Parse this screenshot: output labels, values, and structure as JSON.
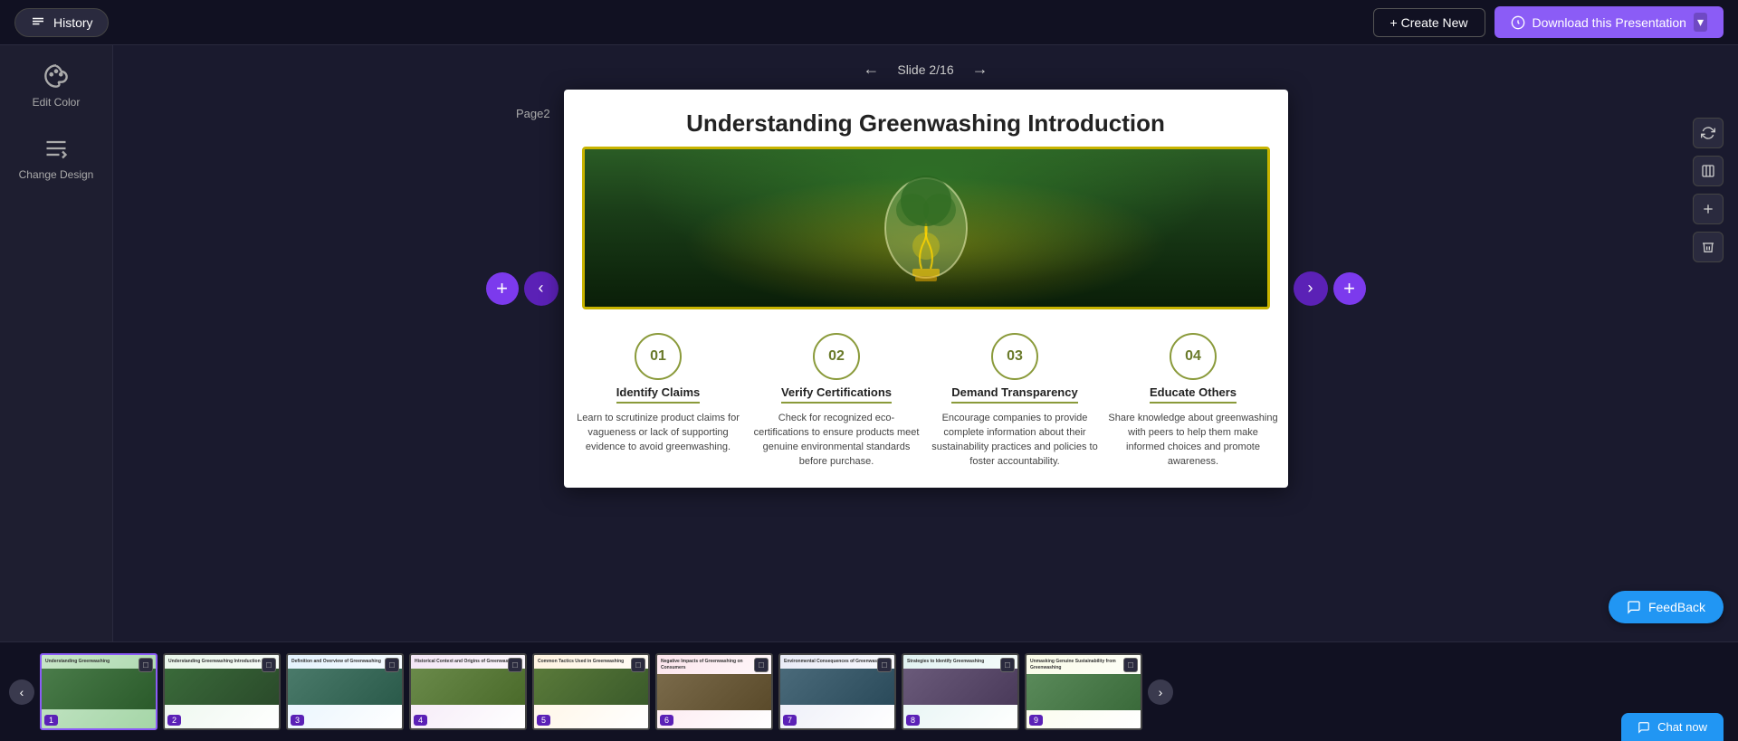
{
  "topbar": {
    "history_label": "History",
    "create_new_label": "+ Create New",
    "download_label": "Download this Presentation"
  },
  "sidebar": {
    "edit_color_label": "Edit Color",
    "change_design_label": "Change Design"
  },
  "slide": {
    "page_label": "Page2",
    "nav_label": "Slide 2/16",
    "title": "Understanding Greenwashing Introduction",
    "points": [
      {
        "number": "01",
        "title": "Identify Claims",
        "desc": "Learn to scrutinize product claims for vagueness or lack of supporting evidence to avoid greenwashing."
      },
      {
        "number": "02",
        "title": "Verify Certifications",
        "desc": "Check for recognized eco-certifications to ensure products meet genuine environmental standards before purchase."
      },
      {
        "number": "03",
        "title": "Demand Transparency",
        "desc": "Encourage companies to provide complete information about their sustainability practices and policies to foster accountability."
      },
      {
        "number": "04",
        "title": "Educate Others",
        "desc": "Share knowledge about greenwashing with peers to help them make informed choices and promote awareness."
      }
    ]
  },
  "thumbnails": [
    {
      "badge": "1",
      "label": "Understanding Greenwashing...",
      "color": "t1",
      "active": true
    },
    {
      "badge": "2",
      "label": "Understanding Greenwashing Introduction",
      "color": "t2",
      "active": false
    },
    {
      "badge": "3",
      "label": "Definition and Overview...",
      "color": "t3",
      "active": false
    },
    {
      "badge": "4",
      "label": "Historical Context and Origins...",
      "color": "t4",
      "active": false
    },
    {
      "badge": "5",
      "label": "Common Tactics Used...",
      "color": "t5",
      "active": false
    },
    {
      "badge": "6",
      "label": "Negative Impacts of Greenwashing...",
      "color": "t6",
      "active": false
    },
    {
      "badge": "7",
      "label": "Environmental Consequences...",
      "color": "t7",
      "active": false
    },
    {
      "badge": "8",
      "label": "Strategies to Identify...",
      "color": "t8",
      "active": false
    },
    {
      "badge": "9",
      "label": "Unmasking Genuine Sustainability...",
      "color": "t9",
      "active": false
    }
  ],
  "feedback": {
    "label": "FeedBack"
  },
  "chat": {
    "label": "Chat now"
  }
}
